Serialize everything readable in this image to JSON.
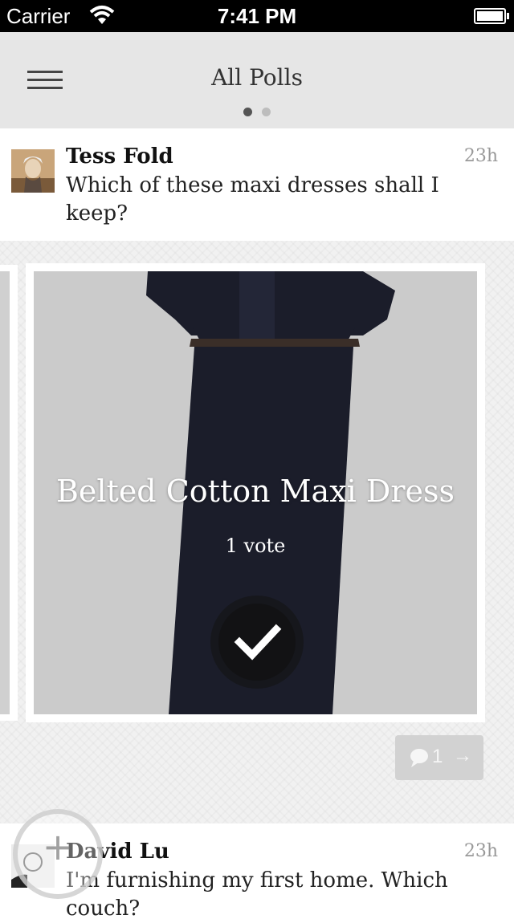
{
  "status_bar": {
    "carrier": "Carrier",
    "time": "7:41 PM"
  },
  "nav": {
    "title": "All Polls",
    "menu_icon": "hamburger-menu-icon",
    "page_count": 2,
    "active_page": 1
  },
  "polls": [
    {
      "author": "Tess Fold",
      "time_ago": "23h",
      "question": "Which of these maxi dresses shall I keep?",
      "option": {
        "label": "Belted Cotton Maxi Dress",
        "votes": "1 vote",
        "voted_icon": "checkmark-icon"
      },
      "comments": {
        "count": "1",
        "arrow": "→"
      }
    },
    {
      "author": "David Lu",
      "time_ago": "23h",
      "question": "I'm furnishing my first home. Which couch?"
    }
  ],
  "add_button": {
    "symbol": "+",
    "icon": "plus-icon"
  },
  "colors": {
    "nav_bg": "#e6e6e6",
    "feed_bg": "#f1f1f1",
    "dress": "#1b1d2a",
    "image_bg": "#cbcbcb",
    "comment_bg": "#d2d2d2"
  }
}
